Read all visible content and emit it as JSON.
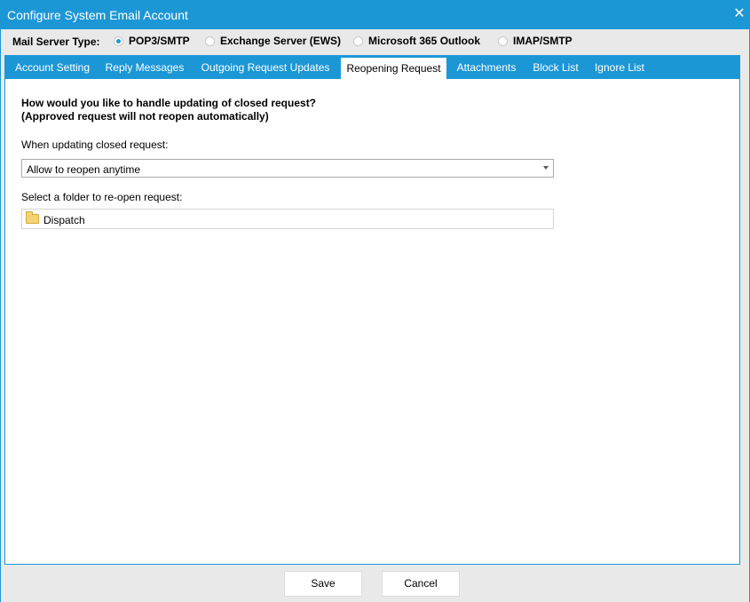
{
  "window": {
    "title": "Configure System Email Account",
    "close_glyph": "✕"
  },
  "server_type": {
    "label": "Mail Server Type:",
    "options": [
      {
        "label": "POP3/SMTP",
        "selected": true
      },
      {
        "label": "Exchange Server (EWS)",
        "selected": false
      },
      {
        "label": "Microsoft 365 Outlook",
        "selected": false
      },
      {
        "label": "IMAP/SMTP",
        "selected": false
      }
    ]
  },
  "tabs": [
    {
      "label": "Account Setting",
      "active": false
    },
    {
      "label": "Reply Messages",
      "active": false
    },
    {
      "label": "Outgoing Request Updates",
      "active": false
    },
    {
      "label": "Reopening Request",
      "active": true
    },
    {
      "label": "Attachments",
      "active": false
    },
    {
      "label": "Block List",
      "active": false
    },
    {
      "label": "Ignore List",
      "active": false
    }
  ],
  "reopening": {
    "question_line1": "How would you like to handle updating of closed request?",
    "question_line2": "(Approved request will not reopen automatically)",
    "when_label": "When updating closed request:",
    "when_value": "Allow to reopen anytime",
    "folder_label": "Select a folder to re-open request:",
    "folder_value": "Dispatch"
  },
  "footer": {
    "save_label": "Save",
    "cancel_label": "Cancel"
  },
  "colors": {
    "accent": "#1c97d6",
    "folder": "#f2d472"
  }
}
